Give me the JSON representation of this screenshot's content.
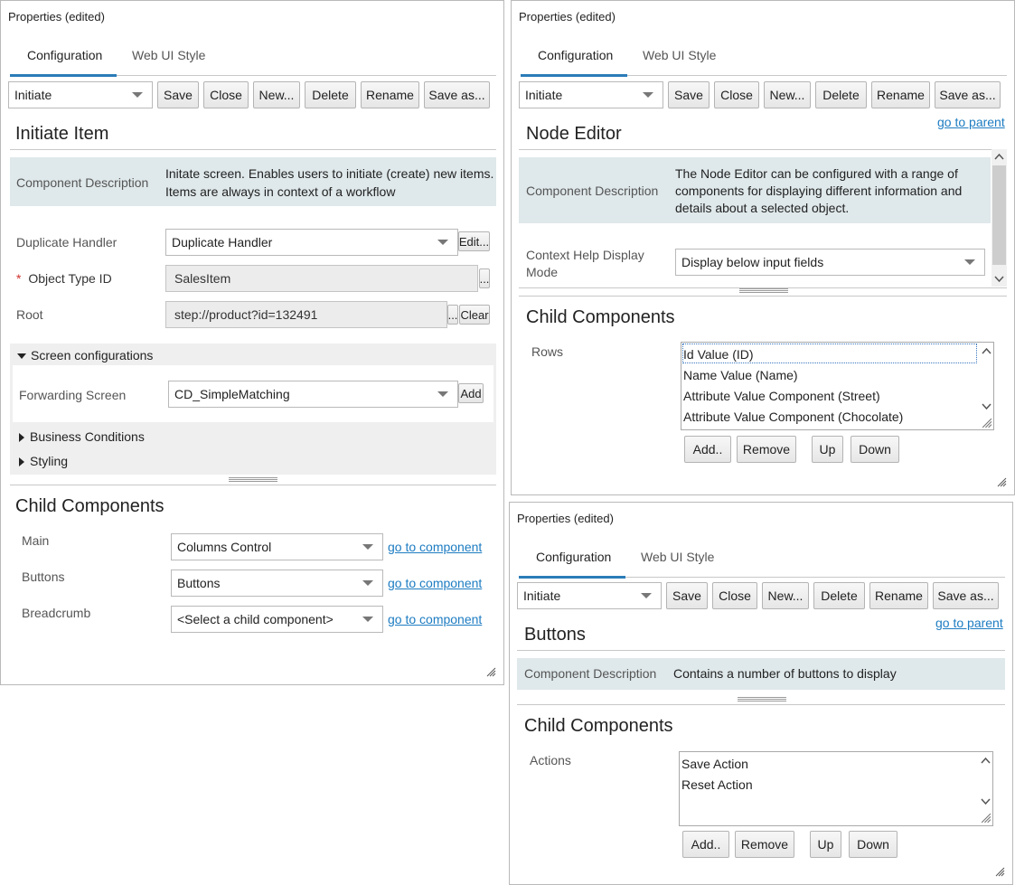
{
  "colors": {
    "accent": "#2b7cb8",
    "link": "#1d7cc2",
    "description_bg": "#dfe8ea",
    "required": "#d0312d"
  },
  "panel1": {
    "title": "Properties (edited)",
    "tabs": [
      "Configuration",
      "Web UI Style"
    ],
    "config_select": "Initiate",
    "buttons": [
      "Save",
      "Close",
      "New...",
      "Delete",
      "Rename",
      "Save as..."
    ],
    "heading": "Initiate Item",
    "description_label": "Component Description",
    "description_lines": [
      "Initate screen. Enables users to initiate (create) new items.",
      "Items are always in context of a workflow"
    ],
    "fields": {
      "duplicate_handler_label": "Duplicate Handler",
      "duplicate_handler_value": "Duplicate Handler",
      "edit_button": "Edit...",
      "object_type_label": "Object Type ID",
      "required_mark": "*",
      "object_type_value": "SalesItem",
      "ellipsis_button": "...",
      "root_label": "Root",
      "root_value": "step://product?id=132491",
      "root_ellipsis_button": "...",
      "clear_button": "Clear"
    },
    "sections": {
      "screen_configurations": "Screen configurations",
      "forwarding_label": "Forwarding Screen",
      "forwarding_value": "CD_SimpleMatching",
      "add_button": "Add",
      "business_conditions": "Business Conditions",
      "styling": "Styling"
    },
    "child_heading": "Child Components",
    "children": [
      {
        "label": "Main",
        "value": "Columns Control",
        "link": "go to component"
      },
      {
        "label": "Buttons",
        "value": "Buttons",
        "link": "go to component"
      },
      {
        "label": "Breadcrumb",
        "value": "<Select a child component>",
        "link": "go to component"
      }
    ]
  },
  "panel2": {
    "title": "Properties (edited)",
    "tabs": [
      "Configuration",
      "Web UI Style"
    ],
    "config_select": "Initiate",
    "buttons": [
      "Save",
      "Close",
      "New...",
      "Delete",
      "Rename",
      "Save as..."
    ],
    "go_to_parent": "go to parent",
    "heading": "Node Editor",
    "description_label": "Component Description",
    "description_lines": [
      "The Node Editor can be configured with a range of",
      "components for displaying different information and",
      "details about a selected object."
    ],
    "context_help_label_lines": [
      "Context Help Display",
      "Mode"
    ],
    "context_help_value": "Display below input fields",
    "child_heading": "Child Components",
    "rows_label": "Rows",
    "rows": [
      "Id Value (ID)",
      "Name Value (Name)",
      "Attribute Value Component (Street)",
      "Attribute Value Component (Chocolate)"
    ],
    "list_buttons": [
      "Add..",
      "Remove",
      "Up",
      "Down"
    ]
  },
  "panel3": {
    "title": "Properties (edited)",
    "tabs": [
      "Configuration",
      "Web UI Style"
    ],
    "config_select": "Initiate",
    "buttons": [
      "Save",
      "Close",
      "New...",
      "Delete",
      "Rename",
      "Save as..."
    ],
    "go_to_parent": "go to parent",
    "heading": "Buttons",
    "description_label": "Component Description",
    "description_text": "Contains a number of buttons to display",
    "child_heading": "Child Components",
    "actions_label": "Actions",
    "actions": [
      "Save Action",
      "Reset Action"
    ],
    "list_buttons": [
      "Add..",
      "Remove",
      "Up",
      "Down"
    ]
  }
}
